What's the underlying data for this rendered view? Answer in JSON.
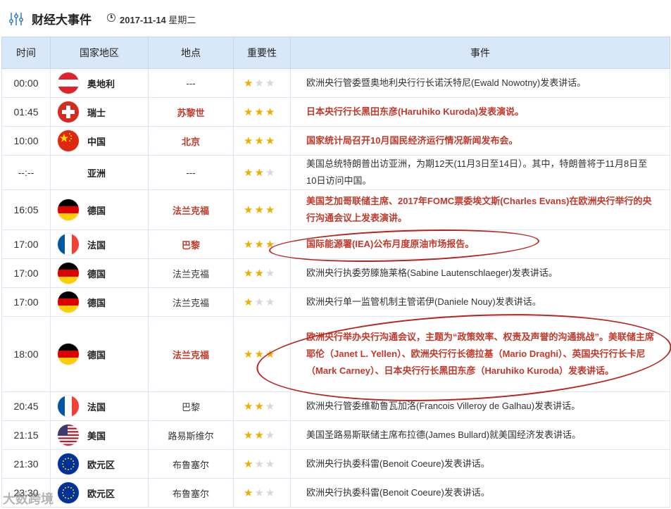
{
  "header": {
    "title": "财经大事件",
    "date": "2017-11-14",
    "weekday": "星期二"
  },
  "columns": [
    "时间",
    "国家地区",
    "地点",
    "重要性",
    "事件"
  ],
  "rows": [
    {
      "time": "00:00",
      "country": "奥地利",
      "flag": "austria",
      "location": "---",
      "stars": 1,
      "event": "欧洲央行管委暨奥地利央行行长诺沃特尼(Ewald Nowotny)发表讲话。",
      "highlight": false
    },
    {
      "time": "01:45",
      "country": "瑞士",
      "flag": "switzerland",
      "location": "苏黎世",
      "stars": 3,
      "event": "日本央行行长黑田东彦(Haruhiko Kuroda)发表演说。",
      "highlight": true
    },
    {
      "time": "10:00",
      "country": "中国",
      "flag": "china",
      "location": "北京",
      "stars": 3,
      "event": "国家统计局召开10月国民经济运行情况新闻发布会。",
      "highlight": true
    },
    {
      "time": "--:--",
      "country": "亚洲",
      "flag": "none",
      "location": "---",
      "stars": 2,
      "event": "美国总统特朗普出访亚洲，为期12天(11月3日至14日）。其中，特朗普将于11月8日至10日访问中国。",
      "highlight": false
    },
    {
      "time": "16:05",
      "country": "德国",
      "flag": "germany",
      "location": "法兰克福",
      "stars": 3,
      "event": "美国芝加哥联储主席、2017年FOMC票委埃文斯(Charles Evans)在欧洲央行举行的央行沟通会议上发表演讲。",
      "highlight": true
    },
    {
      "time": "17:00",
      "country": "法国",
      "flag": "france",
      "location": "巴黎",
      "stars": 3,
      "event": "国际能源署(IEA)公布月度原油市场报告。",
      "highlight": true
    },
    {
      "time": "17:00",
      "country": "德国",
      "flag": "germany",
      "location": "法兰克福",
      "stars": 2,
      "event": "欧洲央行执委劳滕施莱格(Sabine Lautenschlaeger)发表讲话。",
      "highlight": false
    },
    {
      "time": "17:00",
      "country": "德国",
      "flag": "germany",
      "location": "法兰克福",
      "stars": 1,
      "event": "欧洲央行单一监管机制主管诺伊(Daniele Nouy)发表讲话。",
      "highlight": false
    },
    {
      "time": "18:00",
      "country": "德国",
      "flag": "germany",
      "location": "法兰克福",
      "stars": 3,
      "event": "欧洲央行举办央行沟通会议，主题为“政策效率、权责及声誉的沟通挑战”。美联储主席耶伦（Janet L. Yellen）、欧洲央行行长德拉基（Mario Draghi）、英国央行行长卡尼（Mark Carney）、日本央行行长黑田东彦（Haruhiko Kuroda）发表讲话。",
      "highlight": true
    },
    {
      "time": "20:45",
      "country": "法国",
      "flag": "france",
      "location": "巴黎",
      "stars": 2,
      "event": "欧洲央行管委维勒鲁瓦加洛(Francois Villeroy de Galhau)发表讲话。",
      "highlight": false
    },
    {
      "time": "21:15",
      "country": "美国",
      "flag": "usa",
      "location": "路易斯维尔",
      "stars": 2,
      "event": "美国圣路易斯联储主席布拉德(James Bullard)就美国经济发表讲话。",
      "highlight": false
    },
    {
      "time": "21:30",
      "country": "欧元区",
      "flag": "eu",
      "location": "布鲁塞尔",
      "stars": 1,
      "event": "欧洲央行执委科雷(Benoit Coeure)发表讲话。",
      "highlight": false
    },
    {
      "time": "23:30",
      "country": "欧元区",
      "flag": "eu",
      "location": "布鲁塞尔",
      "stars": 1,
      "event": "欧洲央行执委科雷(Benoit Coeure)发表讲话。",
      "highlight": false
    }
  ],
  "watermark": "大数跨境",
  "colors": {
    "accent_red": "#c0392b",
    "header_bg": "#d9e8f8",
    "star_on": "#f0ad00",
    "star_off": "#d8d8d8"
  }
}
